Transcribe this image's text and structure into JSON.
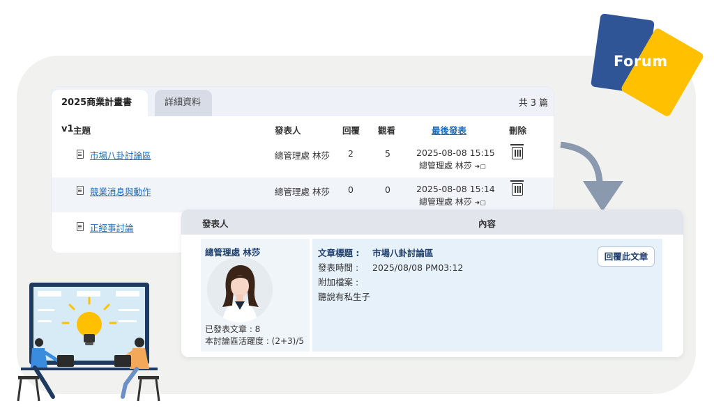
{
  "logo": {
    "text": "Forum"
  },
  "list": {
    "tabs": [
      {
        "label": "2025商業計畫書v1",
        "active": true
      },
      {
        "label": "詳細資料",
        "active": false
      }
    ],
    "total": {
      "prefix": "共",
      "count": "3",
      "suffix": "篇"
    },
    "columns": {
      "topic": "主題",
      "author": "發表人",
      "replies": "回覆",
      "views": "觀看",
      "last_post": "最後發表",
      "delete": "刪除"
    },
    "rows": [
      {
        "topic": "市場八卦討論區",
        "author": "總管理處 林莎",
        "replies": "2",
        "views": "5",
        "last_date": "2025-08-08 15:15",
        "last_user": "總管理處 林莎"
      },
      {
        "topic": "競業消息與動作",
        "author": "總管理處 林莎",
        "replies": "0",
        "views": "0",
        "last_date": "2025-08-08 15:14",
        "last_user": "總管理處 林莎"
      },
      {
        "topic": "正經事討論"
      }
    ]
  },
  "detail": {
    "header": {
      "author": "發表人",
      "content": "內容"
    },
    "poster": {
      "name": "總管理處 林莎",
      "posts": "已發表文章 : 8",
      "activity": "本討論區活躍度 : (2+3)/5"
    },
    "fields": {
      "title_label": "文章標題 :",
      "title_value": "市場八卦討論區",
      "time_label": "發表時間 :",
      "time_value": "2025/08/08 PM03:12",
      "attach_label": "附加檔案 :",
      "body": "聽說有私生子"
    },
    "reply_button": "回覆此文章"
  },
  "colors": {
    "accent_blue": "#2f5597",
    "accent_yellow": "#ffc000",
    "link": "#1e6bb8",
    "arrow": "#8a99ad"
  }
}
